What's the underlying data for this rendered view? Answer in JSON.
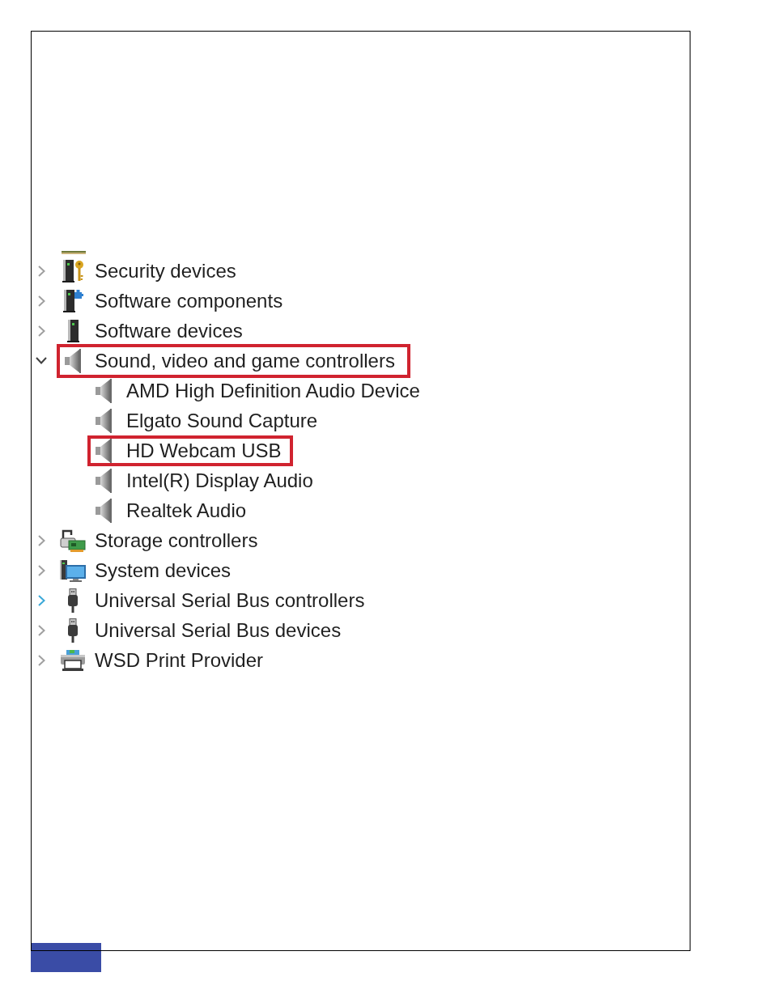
{
  "tree": {
    "items": [
      {
        "label": "Security devices",
        "kind": "security",
        "expanded": false,
        "hovered": false,
        "highlighted": false
      },
      {
        "label": "Software components",
        "kind": "software-components",
        "expanded": false,
        "hovered": false,
        "highlighted": false
      },
      {
        "label": "Software devices",
        "kind": "software-devices",
        "expanded": false,
        "hovered": false,
        "highlighted": false
      },
      {
        "label": "Sound, video and game controllers",
        "kind": "sound",
        "expanded": true,
        "hovered": false,
        "highlighted": true,
        "children": [
          {
            "label": "AMD High Definition Audio Device",
            "kind": "sound",
            "highlighted": false
          },
          {
            "label": "Elgato Sound Capture",
            "kind": "sound",
            "highlighted": false
          },
          {
            "label": "HD Webcam USB",
            "kind": "sound",
            "highlighted": true
          },
          {
            "label": "Intel(R) Display Audio",
            "kind": "sound",
            "highlighted": false
          },
          {
            "label": "Realtek Audio",
            "kind": "sound",
            "highlighted": false
          }
        ]
      },
      {
        "label": "Storage controllers",
        "kind": "storage",
        "expanded": false,
        "hovered": false,
        "highlighted": false
      },
      {
        "label": "System devices",
        "kind": "system",
        "expanded": false,
        "hovered": false,
        "highlighted": false
      },
      {
        "label": "Universal Serial Bus controllers",
        "kind": "usb",
        "expanded": false,
        "hovered": true,
        "highlighted": false
      },
      {
        "label": "Universal Serial Bus devices",
        "kind": "usb",
        "expanded": false,
        "hovered": false,
        "highlighted": false
      },
      {
        "label": "WSD Print Provider",
        "kind": "printer",
        "expanded": false,
        "hovered": false,
        "highlighted": false
      }
    ]
  }
}
